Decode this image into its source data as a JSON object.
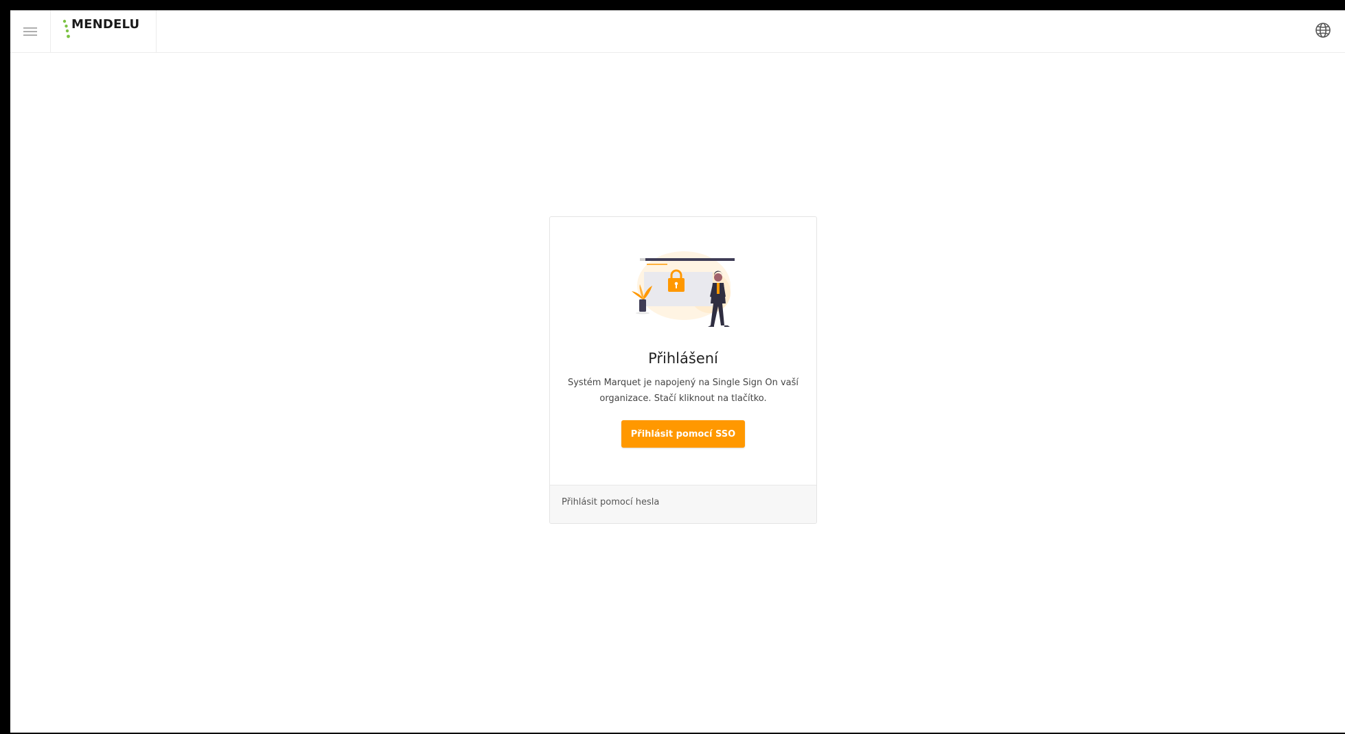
{
  "header": {
    "menu_icon": "hamburger-menu-icon",
    "logo_text": "MENDELU",
    "logo_icon": "mendelu-dots-logo",
    "language_icon": "globe-icon"
  },
  "login_card": {
    "illustration": "secure-login-illustration",
    "title": "Přihlášení",
    "description": "Systém Marquet je napojený na Single Sign On vaší organizace. Stačí kliknout na tlačítko.",
    "sso_button_label": "Přihlásit pomocí SSO",
    "password_link_label": "Přihlásit pomocí hesla"
  },
  "colors": {
    "accent": "#ff9800",
    "logo_green": "#7cc243"
  }
}
